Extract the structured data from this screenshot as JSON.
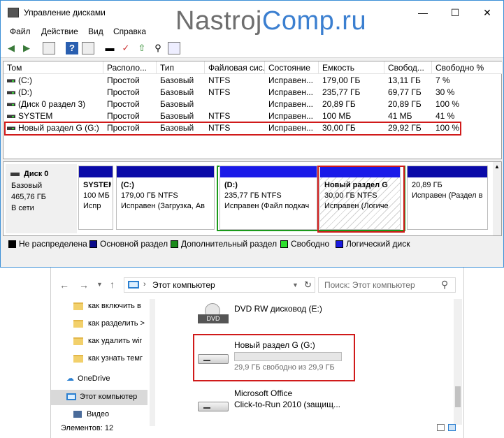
{
  "disk_management": {
    "title": "Управление дисками",
    "menu": [
      "Файл",
      "Действие",
      "Вид",
      "Справка"
    ],
    "columns": [
      "Том",
      "Располо...",
      "Тип",
      "Файловая сис...",
      "Состояние",
      "Емкость",
      "Свобод...",
      "Свободно %"
    ],
    "volumes": [
      [
        "(C:)",
        "Простой",
        "Базовый",
        "NTFS",
        "Исправен...",
        "179,00 ГБ",
        "13,11 ГБ",
        "7 %"
      ],
      [
        "(D:)",
        "Простой",
        "Базовый",
        "NTFS",
        "Исправен...",
        "235,77 ГБ",
        "69,77 ГБ",
        "30 %"
      ],
      [
        "(Диск 0 раздел 3)",
        "Простой",
        "Базовый",
        "",
        "Исправен...",
        "20,89 ГБ",
        "20,89 ГБ",
        "100 %"
      ],
      [
        "SYSTEM",
        "Простой",
        "Базовый",
        "NTFS",
        "Исправен...",
        "100 МБ",
        "41 МБ",
        "41 %"
      ],
      [
        "Новый раздел G (G:)",
        "Простой",
        "Базовый",
        "NTFS",
        "Исправен...",
        "30,00 ГБ",
        "29,92 ГБ",
        "100 %"
      ]
    ],
    "disk": {
      "name": "Диск 0",
      "type": "Базовый",
      "size": "465,76 ГБ",
      "status": "В сети"
    },
    "partitions": [
      {
        "name": "SYSTEM",
        "line2": "100 МБ",
        "line3": "Испр"
      },
      {
        "name": "(C:)",
        "line2": "179,00 ГБ NTFS",
        "line3": "Исправен (Загрузка, Ав"
      },
      {
        "name": "(D:)",
        "line2": "235,77 ГБ NTFS",
        "line3": "Исправен (Файл подкач"
      },
      {
        "name": "Новый раздел G",
        "line2": "30,00 ГБ NTFS",
        "line3": "Исправен (Логиче"
      },
      {
        "name": "",
        "line2": "20,89 ГБ",
        "line3": "Исправен (Раздел в"
      }
    ],
    "legend": [
      {
        "label": "Не распределена",
        "color": "#000000"
      },
      {
        "label": "Основной раздел",
        "color": "#0a0a8a"
      },
      {
        "label": "Дополнительный раздел",
        "color": "#1a8a1a"
      },
      {
        "label": "Свободно",
        "color": "#2de02d"
      },
      {
        "label": "Логический диск",
        "color": "#1a1ae0"
      }
    ]
  },
  "watermark": {
    "part1": "Nastroj",
    "part2": "Comp.ru"
  },
  "explorer": {
    "address": "Этот компьютер",
    "search_placeholder": "Поиск: Этот компьютер",
    "nav_items": [
      "как включить в",
      "как разделить >",
      "как удалить wir",
      "как узнать темг",
      "OneDrive",
      "Этот компьютер",
      "Видео"
    ],
    "status": "Элементов: 12",
    "drives": [
      {
        "name": "DVD RW дисковод (E:)",
        "detail": "",
        "icon": "dvd-drive-icon"
      },
      {
        "name": "Новый раздел G (G:)",
        "detail": "29,9 ГБ свободно из 29,9 ГБ",
        "used_fraction": 0.0,
        "icon": "hard-drive-icon"
      },
      {
        "name": "Microsoft Office",
        "detail": "Click-to-Run 2010 (защищ...",
        "icon": "hard-drive-icon"
      }
    ]
  }
}
